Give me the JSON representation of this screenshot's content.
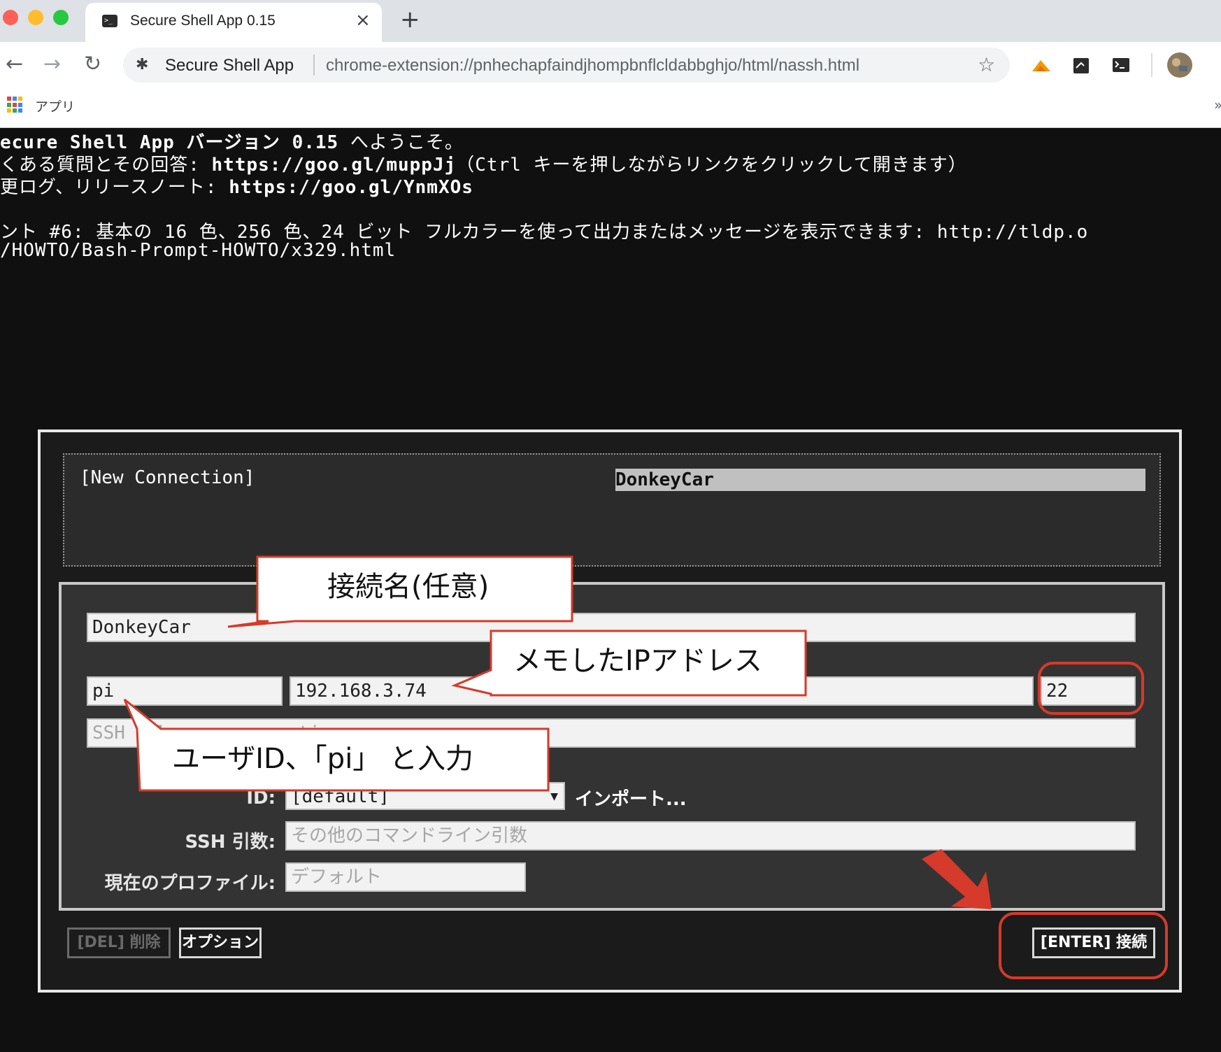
{
  "browser": {
    "tab_title": "Secure Shell App 0.15",
    "tab_close": "×",
    "new_tab": "+",
    "back": "←",
    "forward": "→",
    "reload": "↻",
    "site_name": "Secure Shell App",
    "url": "chrome-extension://pnhechapfaindjhompbnflcldabbghjo/html/nassh.html",
    "bookmark_star": "☆",
    "bookmarks_apps_label": "アプリ",
    "bookmarks_more": "»",
    "colors": {
      "tabstrip": "#dee1e6",
      "close": "#fe5f57",
      "minimize": "#febc2e",
      "zoom": "#28c840"
    }
  },
  "terminal": {
    "welcome_prefix": "ecure Shell App バージョン ",
    "welcome_version": "0.15",
    "welcome_suffix": " へようこそ。",
    "faq_prefix": "くある質問とその回答: ",
    "faq_link": "https://goo.gl/muppJj",
    "faq_suffix": "（Ctrl キーを押しながらリンクをクリックして開きます）",
    "changelog_prefix": "更ログ、リリースノート: ",
    "changelog_link": "https://goo.gl/YnmXOs",
    "tip_line1": "ント #6: 基本の 16 色、256 色、24 ビット フルカラーを使って出力またはメッセージを表示できます: http://tldp.o",
    "tip_line2": "/HOWTO/Bash-Prompt-HOWTO/x329.html"
  },
  "dialog": {
    "new_connection": "[New Connection]",
    "selected_profile": "DonkeyCar",
    "connection_name_value": "DonkeyCar",
    "username_value": "pi",
    "hostname_value": "192.168.3.74",
    "port_value": "22",
    "relay_placeholder_visible": "SSH",
    "relay_placeholder_tail": "lay server options",
    "identity_label": "ID:",
    "identity_value": "[default]",
    "import_label": "インポート...",
    "ssh_args_label": "SSH 引数:",
    "ssh_args_placeholder": "その他のコマンドライン引数",
    "profile_label": "現在のプロファイル:",
    "profile_placeholder": "デフォルト",
    "del_button": "[DEL] 削除",
    "options_button": "オプション",
    "connect_button": "[ENTER] 接続"
  },
  "annotations": {
    "connection_name": "接続名(任意)",
    "ip_address": "メモしたIPアドレス",
    "user_id": "ユーザID、「pi」 と入力",
    "accent_color": "#d63a2a"
  }
}
